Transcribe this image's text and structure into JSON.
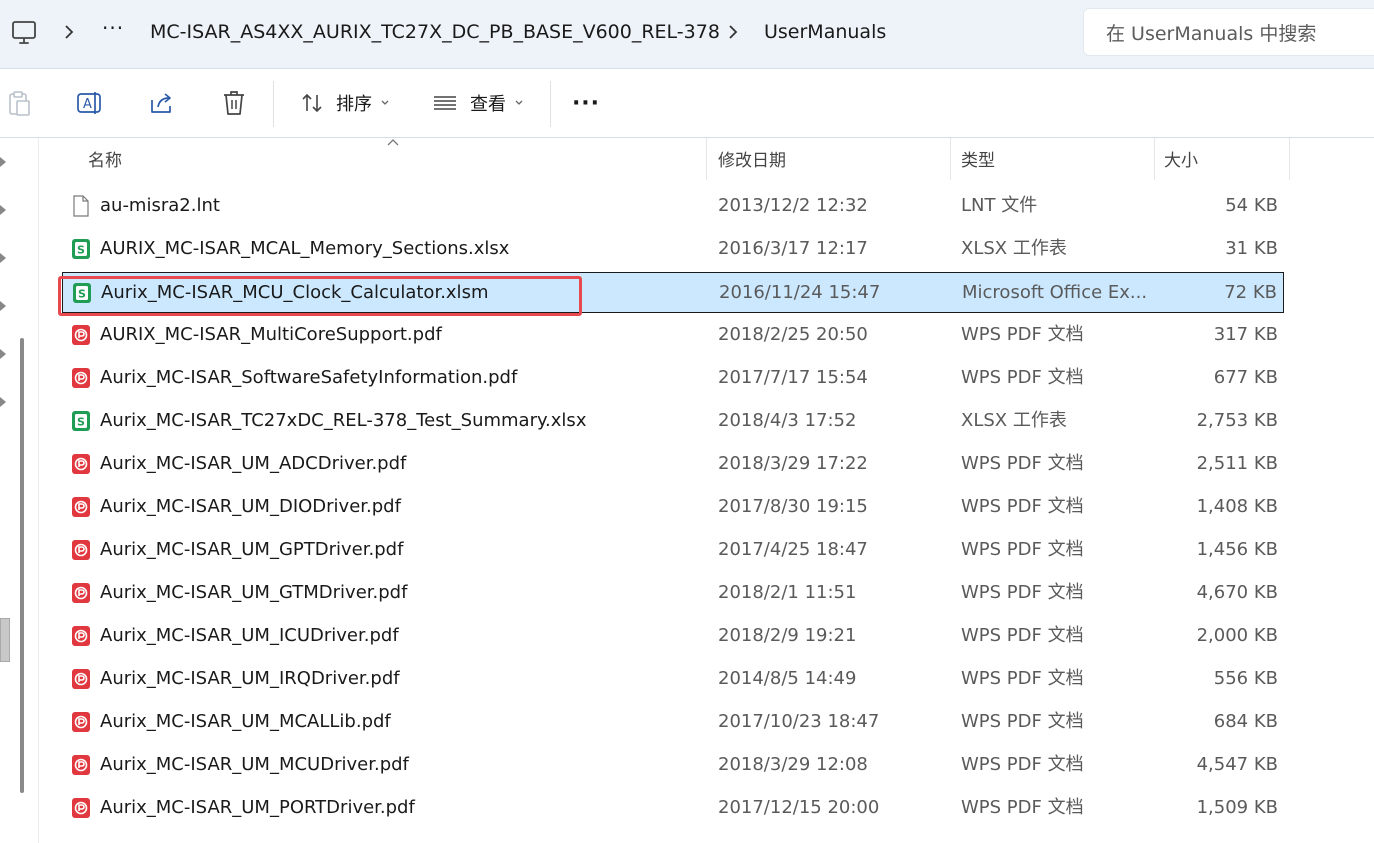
{
  "address_bar": {
    "overflow_label": "···",
    "breadcrumbs": [
      "MC-ISAR_AS4XX_AURIX_TC27X_DC_PB_BASE_V600_REL-378",
      "UserManuals"
    ],
    "search_placeholder": "在 UserManuals 中搜索"
  },
  "command_bar": {
    "sort_label": "排序",
    "view_label": "查看",
    "more_label": "···"
  },
  "columns": {
    "name": "名称",
    "date": "修改日期",
    "type": "类型",
    "size": "大小"
  },
  "files": [
    {
      "name": "au-misra2.lnt",
      "date": "2013/12/2 12:32",
      "type": "LNT 文件",
      "size": "54 KB",
      "icon": "generic-file-icon"
    },
    {
      "name": "AURIX_MC-ISAR_MCAL_Memory_Sections.xlsx",
      "date": "2016/3/17 12:17",
      "type": "XLSX 工作表",
      "size": "31 KB",
      "icon": "spreadsheet-icon"
    },
    {
      "name": "Aurix_MC-ISAR_MCU_Clock_Calculator.xlsm",
      "date": "2016/11/24 15:47",
      "type": "Microsoft Office Ex...",
      "size": "72 KB",
      "icon": "spreadsheet-icon",
      "selected": true
    },
    {
      "name": "AURIX_MC-ISAR_MultiCoreSupport.pdf",
      "date": "2018/2/25 20:50",
      "type": "WPS PDF 文档",
      "size": "317 KB",
      "icon": "pdf-icon"
    },
    {
      "name": "Aurix_MC-ISAR_SoftwareSafetyInformation.pdf",
      "date": "2017/7/17 15:54",
      "type": "WPS PDF 文档",
      "size": "677 KB",
      "icon": "pdf-icon"
    },
    {
      "name": "Aurix_MC-ISAR_TC27xDC_REL-378_Test_Summary.xlsx",
      "date": "2018/4/3 17:52",
      "type": "XLSX 工作表",
      "size": "2,753 KB",
      "icon": "spreadsheet-icon"
    },
    {
      "name": "Aurix_MC-ISAR_UM_ADCDriver.pdf",
      "date": "2018/3/29 17:22",
      "type": "WPS PDF 文档",
      "size": "2,511 KB",
      "icon": "pdf-icon"
    },
    {
      "name": "Aurix_MC-ISAR_UM_DIODriver.pdf",
      "date": "2017/8/30 19:15",
      "type": "WPS PDF 文档",
      "size": "1,408 KB",
      "icon": "pdf-icon"
    },
    {
      "name": "Aurix_MC-ISAR_UM_GPTDriver.pdf",
      "date": "2017/4/25 18:47",
      "type": "WPS PDF 文档",
      "size": "1,456 KB",
      "icon": "pdf-icon"
    },
    {
      "name": "Aurix_MC-ISAR_UM_GTMDriver.pdf",
      "date": "2018/2/1 11:51",
      "type": "WPS PDF 文档",
      "size": "4,670 KB",
      "icon": "pdf-icon"
    },
    {
      "name": "Aurix_MC-ISAR_UM_ICUDriver.pdf",
      "date": "2018/2/9 19:21",
      "type": "WPS PDF 文档",
      "size": "2,000 KB",
      "icon": "pdf-icon"
    },
    {
      "name": "Aurix_MC-ISAR_UM_IRQDriver.pdf",
      "date": "2014/8/5 14:49",
      "type": "WPS PDF 文档",
      "size": "556 KB",
      "icon": "pdf-icon"
    },
    {
      "name": "Aurix_MC-ISAR_UM_MCALLib.pdf",
      "date": "2017/10/23 18:47",
      "type": "WPS PDF 文档",
      "size": "684 KB",
      "icon": "pdf-icon"
    },
    {
      "name": "Aurix_MC-ISAR_UM_MCUDriver.pdf",
      "date": "2018/3/29 12:08",
      "type": "WPS PDF 文档",
      "size": "4,547 KB",
      "icon": "pdf-icon"
    },
    {
      "name": "Aurix_MC-ISAR_UM_PORTDriver.pdf",
      "date": "2017/12/15 20:00",
      "type": "WPS PDF 文档",
      "size": "1,509 KB",
      "icon": "pdf-icon"
    }
  ],
  "colors": {
    "selection": "#cce8ff",
    "highlight": "#e8494f",
    "spreadsheet": "#1f9d55",
    "pdf": "#e0383e"
  }
}
